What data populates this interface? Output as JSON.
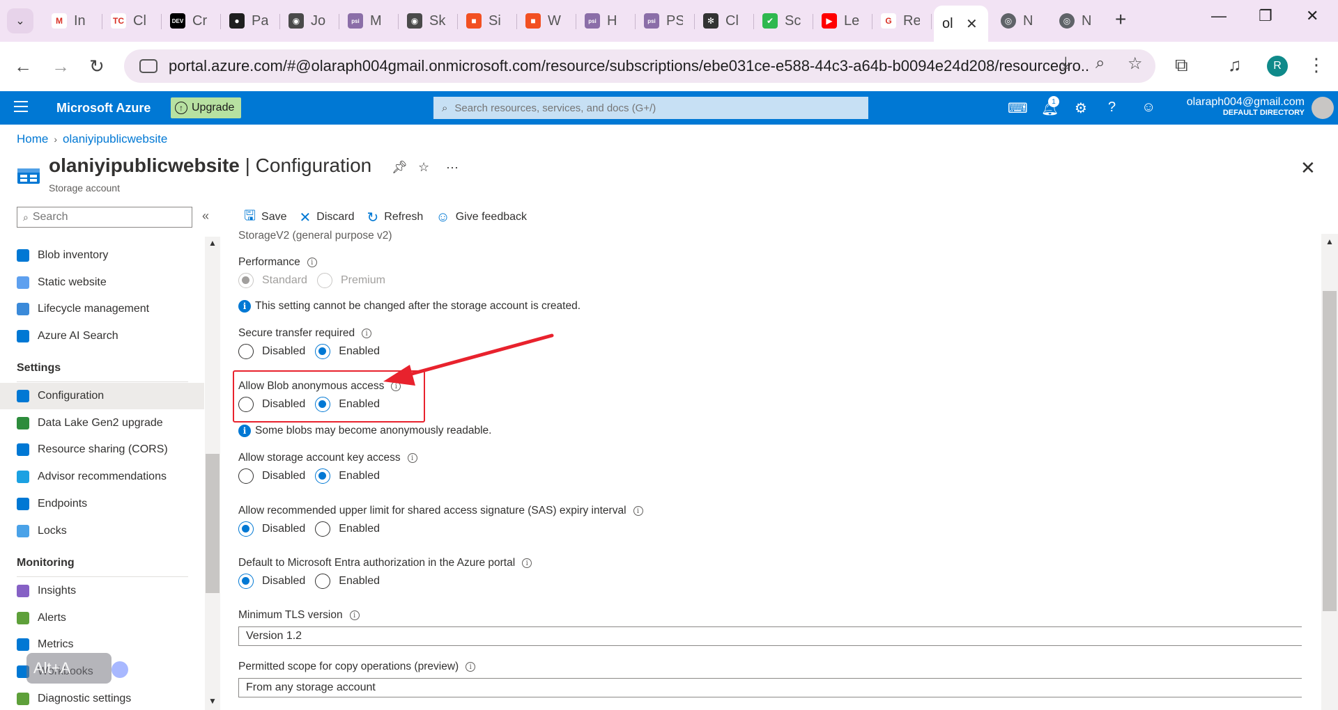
{
  "browser": {
    "tabs": [
      {
        "label": "In",
        "icon": "gmail-icon",
        "color": "#ffffff",
        "glyph": "M"
      },
      {
        "label": "Cl",
        "icon": "tc-icon",
        "color": "#ffffff",
        "glyph": "TC"
      },
      {
        "label": "Cr",
        "icon": "dev-icon",
        "color": "#000000",
        "glyph": "DEV"
      },
      {
        "label": "Pa",
        "icon": "github-icon",
        "color": "#1f1f1f",
        "glyph": "●"
      },
      {
        "label": "Jo",
        "icon": "globe-icon",
        "color": "#4a4a4a",
        "glyph": "◉"
      },
      {
        "label": "M",
        "icon": "psi-icon",
        "color": "#8b6ea8",
        "glyph": "psi"
      },
      {
        "label": "Sk",
        "icon": "globe-icon",
        "color": "#4a4a4a",
        "glyph": "◉"
      },
      {
        "label": "Si",
        "icon": "microsoft-icon",
        "color": "#f25022",
        "glyph": "■"
      },
      {
        "label": "W",
        "icon": "microsoft-icon",
        "color": "#f25022",
        "glyph": "■"
      },
      {
        "label": "H",
        "icon": "psi-icon",
        "color": "#8b6ea8",
        "glyph": "psi"
      },
      {
        "label": "PS",
        "icon": "psi-icon",
        "color": "#8b6ea8",
        "glyph": "psi"
      },
      {
        "label": "Cl",
        "icon": "chatgpt-icon",
        "color": "#333333",
        "glyph": "✻"
      },
      {
        "label": "Sc",
        "icon": "check-icon",
        "color": "#2fb84f",
        "glyph": "✔"
      },
      {
        "label": "Le",
        "icon": "youtube-icon",
        "color": "#ff0000",
        "glyph": "▶"
      },
      {
        "label": "Re",
        "icon": "google-icon",
        "color": "#ffffff",
        "glyph": "G"
      }
    ],
    "active_tab": {
      "label": "ol",
      "close": "✕"
    },
    "extra_tabs": [
      {
        "label": "N",
        "icon": "chrome-icon",
        "glyph": "◎"
      },
      {
        "label": "N",
        "icon": "chrome-icon",
        "glyph": "◎"
      }
    ],
    "new_tab": "+",
    "url": "portal.azure.com/#@olaraph004gmail.onmicrosoft.com/resource/subscriptions/ebe031ce-e588-44c3-a64b-b0094e24d208/resourcegro...",
    "profile_initial": "R"
  },
  "azure": {
    "brand": "Microsoft Azure",
    "upgrade": "Upgrade",
    "search_placeholder": "Search resources, services, and docs (G+/)",
    "notifications_count": "1",
    "account_email": "olaraph004@gmail.com",
    "account_directory": "DEFAULT DIRECTORY"
  },
  "breadcrumb": {
    "home": "Home",
    "resource": "olaniyipublicwebsite"
  },
  "blade": {
    "resource_name": "olaniyipublicwebsite",
    "page": "| Configuration",
    "subtitle": "Storage account"
  },
  "nav": {
    "search_placeholder": "Search",
    "items_top": [
      {
        "label": "Blob inventory",
        "icon": "blob-inventory-icon",
        "color": "#0078d4"
      },
      {
        "label": "Static website",
        "icon": "static-website-icon",
        "color": "#5ea0ef"
      },
      {
        "label": "Lifecycle management",
        "icon": "lifecycle-icon",
        "color": "#3b8ad9"
      },
      {
        "label": "Azure AI Search",
        "icon": "ai-search-icon",
        "color": "#0078d4"
      }
    ],
    "settings_header": "Settings",
    "settings_items": [
      {
        "label": "Configuration",
        "icon": "configuration-icon",
        "color": "#0078d4",
        "selected": true
      },
      {
        "label": "Data Lake Gen2 upgrade",
        "icon": "data-lake-icon",
        "color": "#2d8c3c"
      },
      {
        "label": "Resource sharing (CORS)",
        "icon": "cors-icon",
        "color": "#0078d4"
      },
      {
        "label": "Advisor recommendations",
        "icon": "advisor-icon",
        "color": "#1ba1e2"
      },
      {
        "label": "Endpoints",
        "icon": "endpoints-icon",
        "color": "#0078d4"
      },
      {
        "label": "Locks",
        "icon": "lock-icon",
        "color": "#4aa2e8"
      }
    ],
    "monitoring_header": "Monitoring",
    "monitoring_items": [
      {
        "label": "Insights",
        "icon": "insights-icon",
        "color": "#8661c5"
      },
      {
        "label": "Alerts",
        "icon": "alerts-icon",
        "color": "#5ea03a"
      },
      {
        "label": "Metrics",
        "icon": "metrics-icon",
        "color": "#0078d4"
      },
      {
        "label": "Workbooks",
        "icon": "workbooks-icon",
        "color": "#0078d4"
      },
      {
        "label": "Diagnostic settings",
        "icon": "diagnostic-icon",
        "color": "#5ea03a"
      }
    ]
  },
  "commands": {
    "save": "Save",
    "discard": "Discard",
    "refresh": "Refresh",
    "feedback": "Give feedback"
  },
  "config": {
    "account_kind_value": "StorageV2 (general purpose v2)",
    "performance": {
      "label": "Performance",
      "options": [
        "Standard",
        "Premium"
      ],
      "selected": "Standard",
      "disabled": true
    },
    "performance_info": "This setting cannot be changed after the storage account is created.",
    "secure_transfer": {
      "label": "Secure transfer required",
      "options": [
        "Disabled",
        "Enabled"
      ],
      "selected": "Enabled"
    },
    "blob_anonymous": {
      "label": "Allow Blob anonymous access",
      "options": [
        "Disabled",
        "Enabled"
      ],
      "selected": "Enabled"
    },
    "blob_anonymous_info": "Some blobs may become anonymously readable.",
    "key_access": {
      "label": "Allow storage account key access",
      "options": [
        "Disabled",
        "Enabled"
      ],
      "selected": "Enabled"
    },
    "sas_limit": {
      "label": "Allow recommended upper limit for shared access signature (SAS) expiry interval",
      "options": [
        "Disabled",
        "Enabled"
      ],
      "selected": "Disabled"
    },
    "entra_default": {
      "label": "Default to Microsoft Entra authorization in the Azure portal",
      "options": [
        "Disabled",
        "Enabled"
      ],
      "selected": "Disabled"
    },
    "tls": {
      "label": "Minimum TLS version",
      "value": "Version 1.2"
    },
    "copy_scope": {
      "label": "Permitted scope for copy operations (preview)",
      "value": "From any storage account"
    }
  },
  "overlay": {
    "hotkey_label": "Alt+A"
  },
  "colors": {
    "azure_blue": "#0078d4",
    "highlight_red": "#e8222d",
    "chrome_tab_bg": "#f2e3f4"
  }
}
